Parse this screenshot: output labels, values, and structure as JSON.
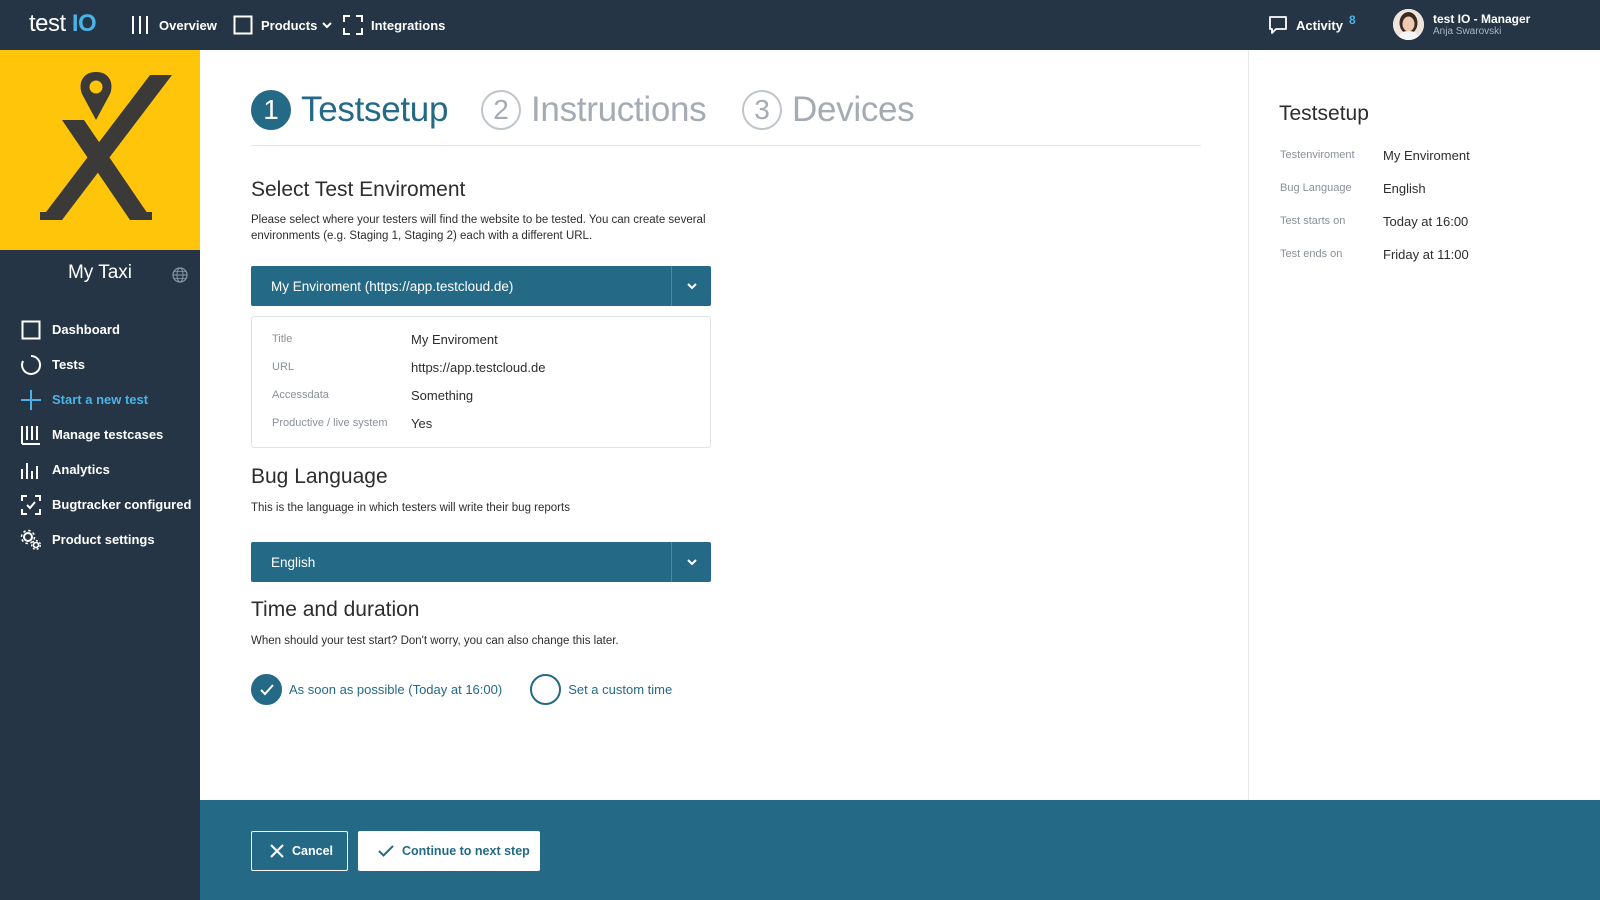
{
  "topbar": {
    "brand_prefix": "test",
    "brand_suffix": "IO",
    "nav": [
      {
        "label": "Overview",
        "icon": "bars-icon"
      },
      {
        "label": "Products",
        "icon": "square-icon"
      },
      {
        "label": "Integrations",
        "icon": "frame-icon"
      }
    ],
    "activity_label": "Activity",
    "activity_count": "8",
    "user_name": "test IO - Manager",
    "user_sub": "Anja Swarovski"
  },
  "sidebar": {
    "product_name": "My Taxi",
    "items": [
      {
        "label": "Dashboard",
        "icon": "square-icon"
      },
      {
        "label": "Tests",
        "icon": "circle-icon"
      },
      {
        "label": "Start a new test",
        "icon": "plus-icon",
        "active": true
      },
      {
        "label": "Manage testcases",
        "icon": "columns-icon"
      },
      {
        "label": "Analytics",
        "icon": "bar-chart-icon"
      },
      {
        "label": "Bugtracker configured",
        "icon": "check-frame-icon"
      },
      {
        "label": "Product settings",
        "icon": "gears-icon"
      }
    ]
  },
  "steps": [
    {
      "num": "1",
      "label": "Testsetup"
    },
    {
      "num": "2",
      "label": "Instructions"
    },
    {
      "num": "3",
      "label": "Devices"
    }
  ],
  "env": {
    "title": "Select Test Enviroment",
    "desc": "Please select where your testers will find the website to be tested. You can create several environments (e.g. Staging 1, Staging 2) each with a different URL.",
    "selected": "My Enviroment (https://app.testcloud.de)",
    "details": [
      {
        "k": "Title",
        "v": "My Enviroment"
      },
      {
        "k": "URL",
        "v": "https://app.testcloud.de"
      },
      {
        "k": "Accessdata",
        "v": "Something"
      },
      {
        "k": "Productive / live system",
        "v": "Yes"
      }
    ]
  },
  "bug_language": {
    "title": "Bug Language",
    "desc": "This is the language in which testers will write their bug reports",
    "selected": "English"
  },
  "time": {
    "title": "Time and duration",
    "desc": "When should your test start? Don't worry, you can also change this later.",
    "option_asap": "As soon as possible (Today at 16:00)",
    "option_custom": "Set a custom time"
  },
  "summary": {
    "title": "Testsetup",
    "rows": [
      {
        "k": "Testenviroment",
        "v": "My Enviroment"
      },
      {
        "k": "Bug Language",
        "v": "English"
      },
      {
        "k": "Test starts on",
        "v": "Today at 16:00"
      },
      {
        "k": "Test ends on",
        "v": "Friday at 11:00"
      }
    ]
  },
  "footer": {
    "cancel_label": "Cancel",
    "next_label": "Continue to next step"
  },
  "colors": {
    "nav_bg": "#263545",
    "accent": "#246a87",
    "highlight": "#4ab2e6",
    "logo_bg": "#ffc50a"
  }
}
